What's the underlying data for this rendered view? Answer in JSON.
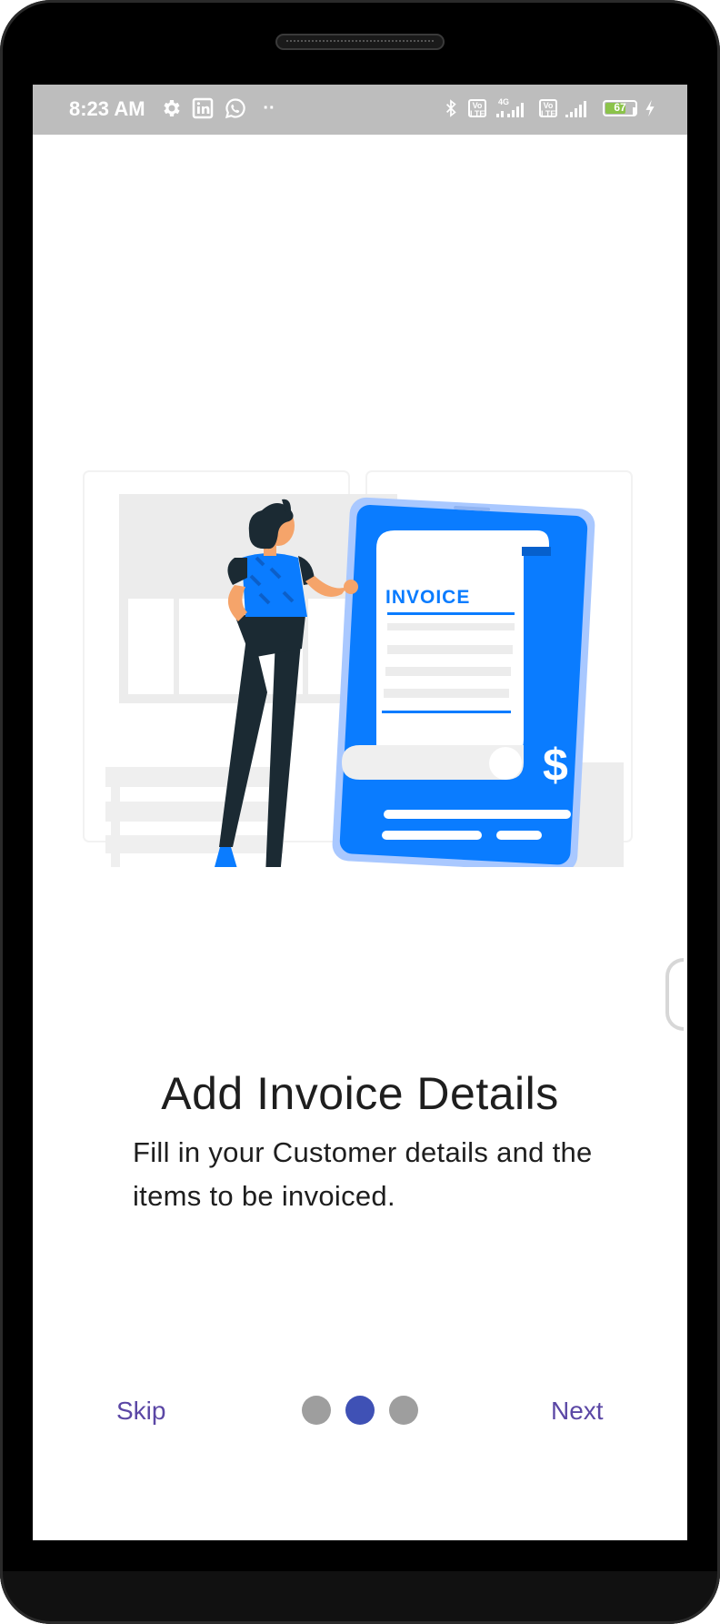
{
  "status_bar": {
    "time": "8:23 AM",
    "volte_label": "Vo LTE",
    "network_label": "4G",
    "battery_level": "67",
    "icons": [
      "gear-icon",
      "linkedin-icon",
      "whatsapp-icon",
      "more-dots-icon",
      "bluetooth-icon",
      "volte-icon",
      "signal-icon",
      "volte-icon",
      "signal-icon",
      "battery-icon",
      "charging-icon"
    ]
  },
  "illustration": {
    "document_title": "INVOICE",
    "currency_symbol": "$"
  },
  "onboarding": {
    "title": "Add Invoice Details",
    "description": "Fill in your Customer details and the items to be invoiced.",
    "skip_label": "Skip",
    "next_label": "Next",
    "page_count": 3,
    "current_page": 2
  },
  "colors": {
    "accent_text": "#5b47a5",
    "active_dot": "#3f51b5",
    "inactive_dot": "#9e9e9e",
    "illustration_blue": "#0a7cff"
  }
}
